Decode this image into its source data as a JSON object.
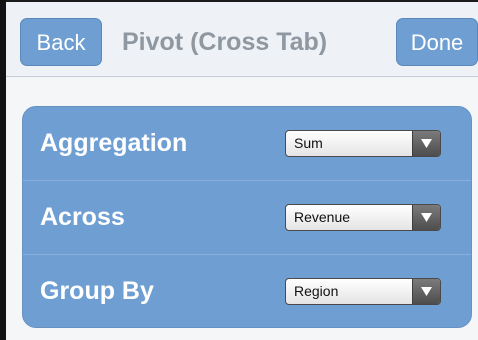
{
  "nav": {
    "back_label": "Back",
    "title": "Pivot (Cross Tab)",
    "done_label": "Done"
  },
  "settings": [
    {
      "label": "Aggregation",
      "value": "Sum"
    },
    {
      "label": "Across",
      "value": "Revenue"
    },
    {
      "label": "Group By",
      "value": "Region"
    }
  ],
  "colors": {
    "accent": "#6f9fd2",
    "title_text": "#8f97a1"
  },
  "icons": {
    "select_arrow": "chevron-down-icon"
  }
}
